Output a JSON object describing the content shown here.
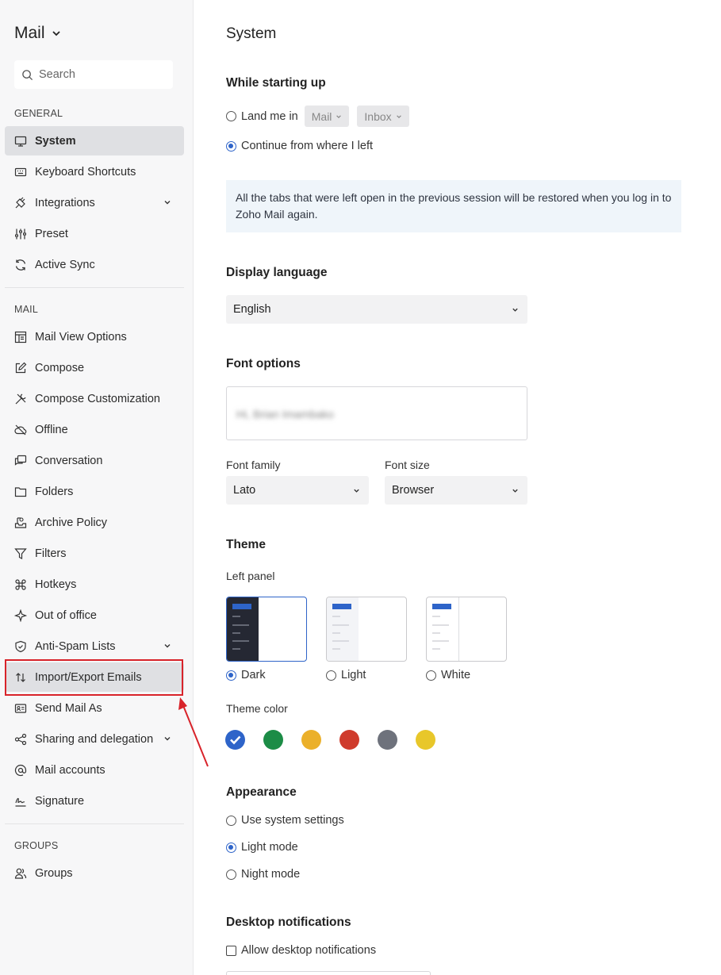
{
  "app": {
    "title": "Mail"
  },
  "search": {
    "placeholder": "Search"
  },
  "sidebar": {
    "general_label": "GENERAL",
    "mail_label": "MAIL",
    "groups_label": "GROUPS",
    "general_items": [
      {
        "label": "System",
        "icon": "monitor-icon",
        "active": true
      },
      {
        "label": "Keyboard Shortcuts",
        "icon": "keyboard-icon"
      },
      {
        "label": "Integrations",
        "icon": "plug-icon",
        "expandable": true
      },
      {
        "label": "Preset",
        "icon": "sliders-icon"
      },
      {
        "label": "Active Sync",
        "icon": "sync-icon"
      }
    ],
    "mail_items": [
      {
        "label": "Mail View Options",
        "icon": "layout-icon"
      },
      {
        "label": "Compose",
        "icon": "edit-icon"
      },
      {
        "label": "Compose Customization",
        "icon": "tools-icon"
      },
      {
        "label": "Offline",
        "icon": "cloud-off-icon"
      },
      {
        "label": "Conversation",
        "icon": "chat-icon"
      },
      {
        "label": "Folders",
        "icon": "folder-icon"
      },
      {
        "label": "Archive Policy",
        "icon": "archive-icon"
      },
      {
        "label": "Filters",
        "icon": "filter-icon"
      },
      {
        "label": "Hotkeys",
        "icon": "command-icon"
      },
      {
        "label": "Out of office",
        "icon": "plane-icon"
      },
      {
        "label": "Anti-Spam Lists",
        "icon": "shield-icon",
        "expandable": true
      },
      {
        "label": "Import/Export Emails",
        "icon": "import-export-icon",
        "highlighted": true
      },
      {
        "label": "Send Mail As",
        "icon": "contact-card-icon"
      },
      {
        "label": "Sharing and delegation",
        "icon": "share-icon",
        "expandable": true
      },
      {
        "label": "Mail accounts",
        "icon": "at-icon"
      },
      {
        "label": "Signature",
        "icon": "signature-icon"
      }
    ],
    "group_items": [
      {
        "label": "Groups",
        "icon": "users-icon"
      }
    ]
  },
  "main": {
    "title": "System",
    "startup": {
      "heading": "While starting up",
      "option_land": "Land me in",
      "land_app": "Mail",
      "land_folder": "Inbox",
      "option_continue": "Continue from where I left",
      "selected": "continue",
      "info": "All the tabs that were left open in the previous session will be restored when you log in to Zoho Mail again."
    },
    "language": {
      "heading": "Display language",
      "value": "English"
    },
    "font": {
      "heading": "Font options",
      "preview_text": "Hi, Brian Imambako",
      "family_label": "Font family",
      "family_value": "Lato",
      "size_label": "Font size",
      "size_value": "Browser"
    },
    "theme": {
      "heading": "Theme",
      "left_panel_label": "Left panel",
      "panels": [
        "Dark",
        "Light",
        "White"
      ],
      "selected_panel": "Dark",
      "color_label": "Theme color",
      "colors": [
        "#2e64c9",
        "#1c8c46",
        "#ebb02a",
        "#cf3b2c",
        "#6e727c",
        "#e8c72a"
      ],
      "selected_color": "#2e64c9"
    },
    "appearance": {
      "heading": "Appearance",
      "options": [
        "Use system settings",
        "Light mode",
        "Night mode"
      ],
      "selected": "Light mode"
    },
    "notifications": {
      "heading": "Desktop notifications",
      "option": "Allow desktop notifications",
      "checked": false
    }
  },
  "annotation": {
    "highlight_color": "#d8232a"
  }
}
